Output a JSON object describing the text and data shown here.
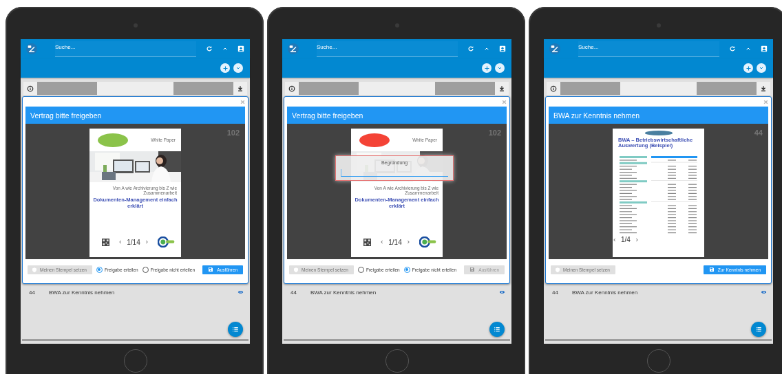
{
  "tablets": [
    {
      "search": {
        "placeholder": "Suche..."
      },
      "dialog": {
        "title": "Vertrag bitte freigeben",
        "number": "102",
        "document": {
          "kind": "whitepaper",
          "color": "#8bc34a",
          "label": "White Paper",
          "subtitle": "Von A wie Archivierung bis Z wie Zusammenarbeit",
          "title": "Dokumenten-Management einfach erklärt"
        },
        "pager": "1/14",
        "stamp_button": {
          "label": "Meinen Stempel setzen",
          "disabled": true
        },
        "options": [
          {
            "label": "Freigabe erteilen",
            "selected": true
          },
          {
            "label": "Freigabe nicht erteilen",
            "selected": false
          }
        ],
        "action": {
          "label": "Ausführen",
          "disabled": false
        }
      },
      "list_row": {
        "number": "44",
        "title": "BWA zur Kenntnis nehmen"
      }
    },
    {
      "search": {
        "placeholder": "Suche..."
      },
      "dialog": {
        "title": "Vertrag bitte freigeben",
        "number": "102",
        "document": {
          "kind": "whitepaper",
          "color": "#f44336",
          "label": "White Paper",
          "subtitle": "Von A wie Archivierung bis Z wie Zusammenarbeit",
          "title": "Dokumenten-Management einfach erklärt"
        },
        "pager": "1/14",
        "stamp_button": {
          "label": "Meinen Stempel setzen",
          "disabled": true
        },
        "options": [
          {
            "label": "Freigabe erteilen",
            "selected": false
          },
          {
            "label": "Freigabe nicht erteilen",
            "selected": true
          }
        ],
        "action": {
          "label": "Ausführen",
          "disabled": true
        },
        "reason_popup": {
          "label": "Begründung"
        }
      },
      "list_row": {
        "number": "44",
        "title": "BWA zur Kenntnis nehmen"
      }
    },
    {
      "search": {
        "placeholder": "Suche..."
      },
      "dialog": {
        "title": "BWA zur Kenntnis nehmen",
        "number": "44",
        "document": {
          "kind": "report",
          "color": "#4a7fa0",
          "title": "BWA – Betriebswirtschaftliche Auswertung (Beispiel)"
        },
        "pager": "1/4",
        "stamp_button": {
          "label": "Meinen Stempel setzen",
          "disabled": true
        },
        "action": {
          "label": "Zur Kenntnis nehmen",
          "disabled": false
        }
      },
      "list_row": {
        "number": "44",
        "title": "BWA zur Kenntnis nehmen"
      }
    }
  ]
}
